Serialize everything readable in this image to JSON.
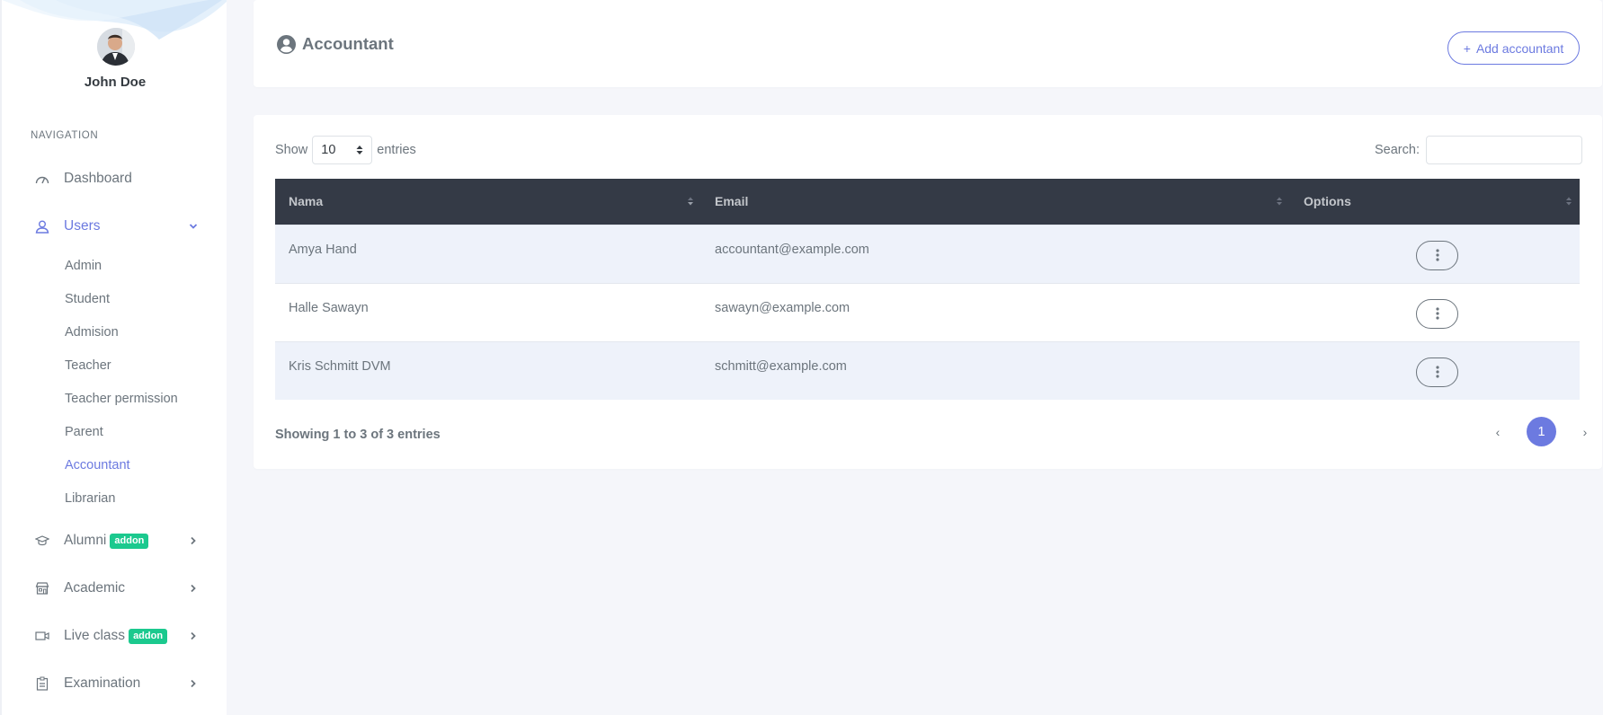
{
  "user": {
    "name": "John Doe"
  },
  "sidebar": {
    "section_title": "NAVIGATION",
    "items": [
      {
        "label": "Dashboard",
        "icon": "dashboard-gauge-icon"
      },
      {
        "label": "Users",
        "icon": "user-icon",
        "expanded": true,
        "children": [
          "Admin",
          "Student",
          "Admision",
          "Teacher",
          "Teacher permission",
          "Parent",
          "Accountant",
          "Librarian"
        ],
        "active_child": "Accountant"
      },
      {
        "label": "Alumni",
        "icon": "graduation-cap-icon",
        "badge": "addon"
      },
      {
        "label": "Academic",
        "icon": "school-building-icon"
      },
      {
        "label": "Live class",
        "icon": "video-camera-icon",
        "badge": "addon"
      },
      {
        "label": "Examination",
        "icon": "clipboard-icon"
      }
    ]
  },
  "header": {
    "title": "Accountant",
    "add_button": "Add accountant",
    "add_button_icon": "+"
  },
  "table_controls": {
    "show_label": "Show",
    "page_length": "10",
    "entries_label": "entries",
    "search_label": "Search:",
    "search_value": ""
  },
  "table": {
    "columns": [
      "Nama",
      "Email",
      "Options"
    ],
    "rows": [
      {
        "name": "Amya Hand",
        "email": "accountant@example.com"
      },
      {
        "name": "Halle Sawayn",
        "email": "sawayn@example.com"
      },
      {
        "name": "Kris Schmitt DVM",
        "email": "schmitt@example.com"
      }
    ]
  },
  "footer": {
    "info": "Showing 1 to 3 of 3 entries",
    "current_page": "1",
    "prev": "‹",
    "next": "›"
  },
  "colors": {
    "accent": "#6c7ae0",
    "badge": "#1bc98e",
    "table_header": "#343a46"
  }
}
